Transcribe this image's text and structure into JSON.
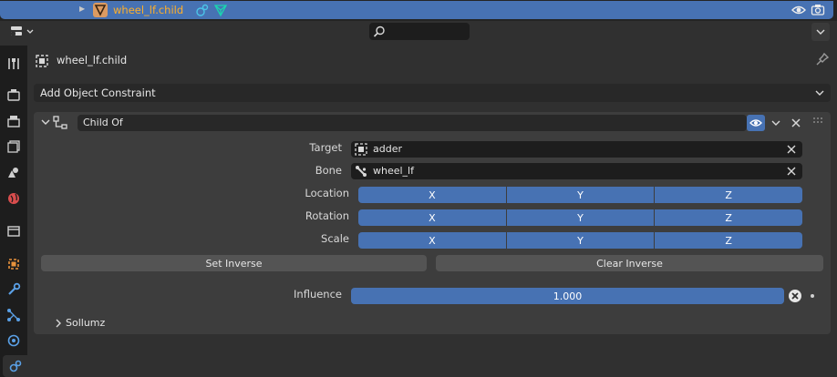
{
  "outliner": {
    "object_name": "wheel_lf.child"
  },
  "properties": {
    "context_object": "wheel_lf.child",
    "add_constraint_label": "Add Object Constraint"
  },
  "constraint": {
    "name": "Child Of",
    "target_label": "Target",
    "target_value": "adder",
    "bone_label": "Bone",
    "bone_value": "wheel_lf",
    "location_label": "Location",
    "rotation_label": "Rotation",
    "scale_label": "Scale",
    "axes": [
      "X",
      "Y",
      "Z"
    ],
    "set_inverse_label": "Set Inverse",
    "clear_inverse_label": "Clear Inverse",
    "influence_label": "Influence",
    "influence_value": "1.000",
    "subpanel_label": "Sollumz"
  },
  "colors": {
    "accent": "#4772b3",
    "object_name": "#ffaf29",
    "panel_bg": "#3d3d3d",
    "field_bg": "#1d1d1d"
  },
  "icons": {
    "outliner": [
      "expand-arrow-icon",
      "mesh-object-icon",
      "constraint-icon",
      "mesh-data-icon",
      "eye-icon",
      "camera-render-icon"
    ],
    "tabs": [
      "tool-icon",
      "render-icon",
      "output-icon",
      "view-layer-icon",
      "scene-icon",
      "world-icon",
      "collection-icon",
      "object-icon",
      "modifier-icon",
      "particles-icon",
      "physics-icon",
      "constraint-icon"
    ]
  }
}
